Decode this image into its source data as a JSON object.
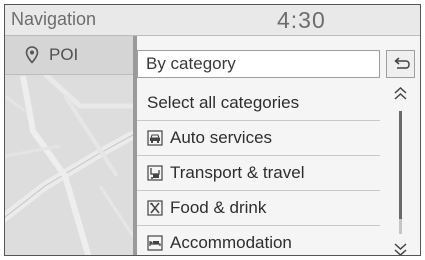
{
  "header": {
    "title": "Navigation",
    "clock": "4:30"
  },
  "sidebar": {
    "tab_label": "POI"
  },
  "panel": {
    "category_header": "By category",
    "items": [
      {
        "label": "Select all categories",
        "icon": null
      },
      {
        "label": "Auto services",
        "icon": "car-service-icon"
      },
      {
        "label": "Transport & travel",
        "icon": "transport-icon"
      },
      {
        "label": "Food & drink",
        "icon": "food-drink-icon"
      },
      {
        "label": "Accommodation",
        "icon": "accommodation-icon"
      }
    ]
  },
  "colors": {
    "text_dark": "#2e2e2e",
    "header_gray": "#6d6d6d",
    "divider": "#9a9a9a"
  }
}
